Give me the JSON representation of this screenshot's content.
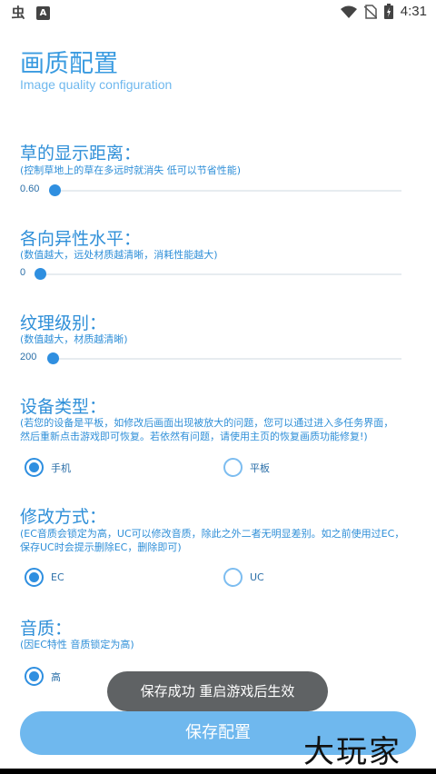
{
  "status_bar": {
    "app_icon": "虫",
    "notification_icon": "A",
    "time": "4:31",
    "icons": [
      "wifi-icon",
      "no-sim-icon",
      "battery-charging-icon"
    ]
  },
  "header": {
    "title": "画质配置",
    "subtitle": "Image quality configuration"
  },
  "grass": {
    "title": "草的显示距离：",
    "desc": "(控制草地上的草在多远时就消失 低可以节省性能)",
    "value": "0.60",
    "fraction": 0.02
  },
  "aniso": {
    "title": "各向异性水平：",
    "desc": "(数值越大，远处材质越清晰，消耗性能越大)",
    "value": "0",
    "fraction": 0.0
  },
  "texture": {
    "title": "纹理级别：",
    "desc": "(数值越大，材质越清晰)",
    "value": "200",
    "fraction": 0.0
  },
  "device": {
    "title": "设备类型：",
    "desc_line1": "(若您的设备是平板，如修改后画面出现被放大的问题，您可以通过进入多任务界面，",
    "desc_line2": "然后重新点击游戏即可恢复。若依然有问题，请使用主页的恢复画质功能修复!)",
    "option1": "手机",
    "option2": "平板",
    "selected": "手机"
  },
  "mode": {
    "title": "修改方式：",
    "desc_line1": "(EC音质会锁定为高，UC可以修改音质，除此之外二者无明显差别。如之前使用过EC，",
    "desc_line2": "保存UC时会提示删除EC，删除即可)",
    "option1": "EC",
    "option2": "UC",
    "selected": "EC"
  },
  "audio": {
    "title": "音质：",
    "desc": "(因EC特性 音质锁定为高)",
    "option1": "高",
    "selected": "高"
  },
  "toast": {
    "text": "保存成功 重启游戏后生效"
  },
  "save_button": {
    "label": "保存配置"
  },
  "watermark": {
    "text": "大玩家"
  },
  "colors": {
    "accent": "#2f8fe0",
    "button": "#6fb8ee",
    "toast": "#5f6264"
  }
}
